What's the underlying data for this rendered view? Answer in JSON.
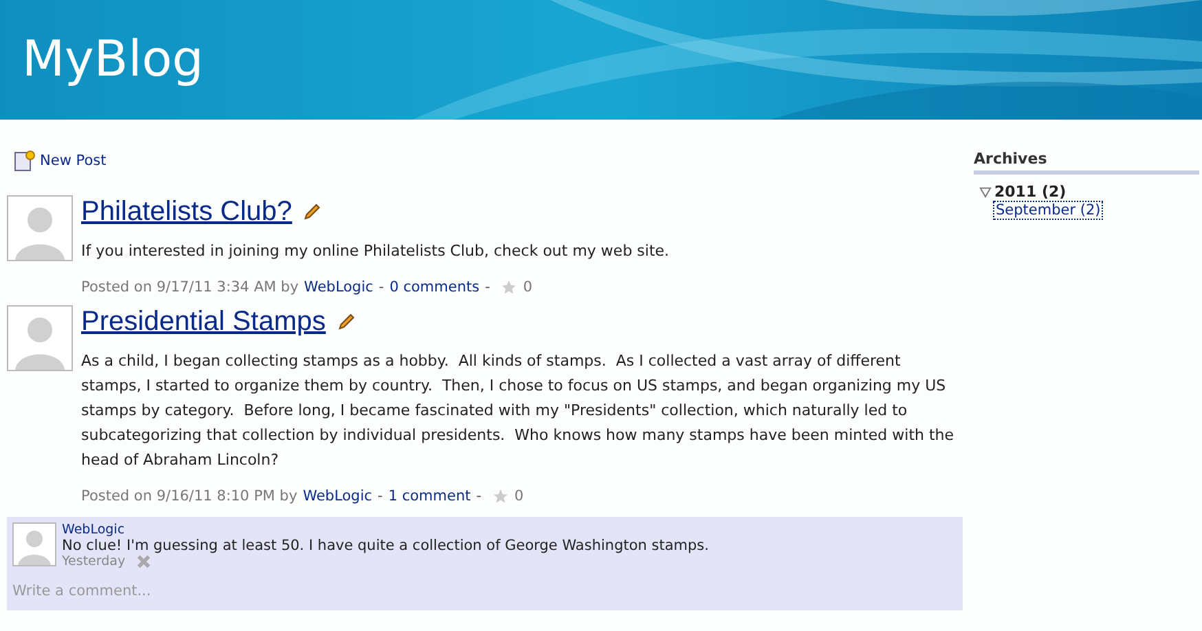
{
  "header": {
    "title": "MyBlog"
  },
  "toolbar": {
    "new_post": "New Post"
  },
  "posts": [
    {
      "title": "Philatelists Club?",
      "body": "If you interested in joining my online Philatelists Club, check out my web site.",
      "meta": {
        "posted": "Posted on 9/17/11 3:34 AM by",
        "author": "WebLogic",
        "comments_link": "0 comments",
        "separators": [
          "-",
          "-"
        ],
        "rating": "0"
      }
    },
    {
      "title": "Presidential Stamps",
      "body": "As a child, I began collecting stamps as a hobby.  All kinds of stamps.  As I collected a vast array of different stamps, I started to organize them by country.  Then, I chose to focus on US stamps, and began organizing my US stamps by category.  Before long, I became fascinated with my \"Presidents\" collection, which naturally led to subcategorizing that collection by individual presidents.  Who knows how many stamps have been minted with the head of Abraham Lincoln?",
      "meta": {
        "posted": "Posted on 9/16/11 8:10 PM by",
        "author": "WebLogic",
        "comments_link": "1 comment",
        "separators": [
          "-",
          "-"
        ],
        "rating": "0"
      },
      "comments": [
        {
          "author": "WebLogic",
          "text": "No clue! I'm guessing at least 50. I have quite a collection of George Washington stamps.",
          "time": "Yesterday"
        }
      ],
      "comment_field": {
        "placeholder": "Write a comment..."
      }
    }
  ],
  "sidebar": {
    "heading": "Archives",
    "years": [
      {
        "label": "2011 (2)",
        "expanded": true,
        "children": [
          {
            "label": "September (2)",
            "selected": true
          }
        ]
      }
    ]
  }
}
